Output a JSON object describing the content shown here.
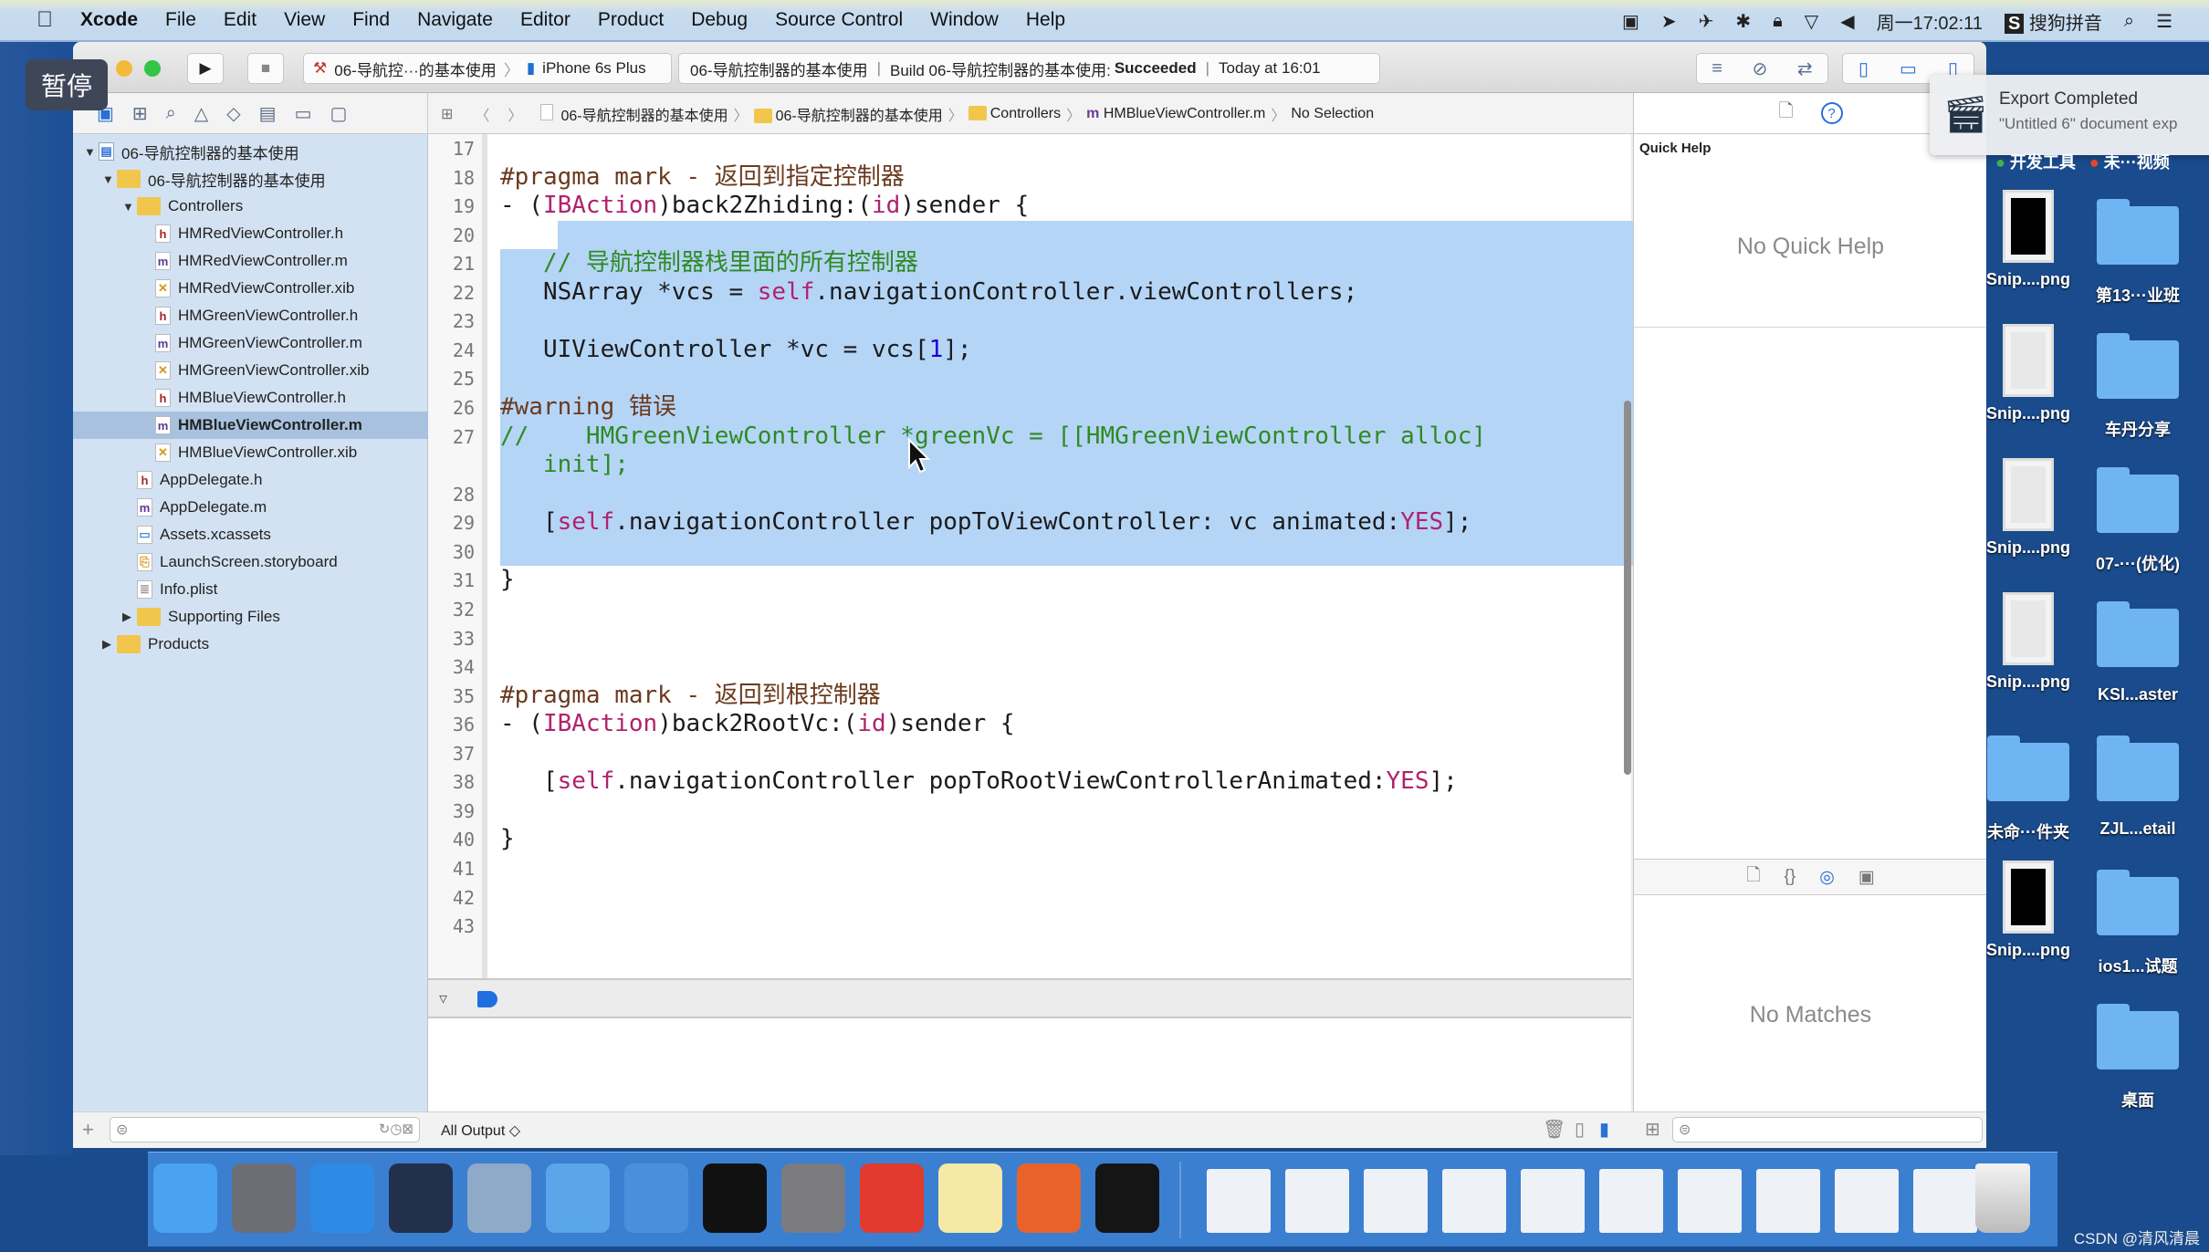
{
  "menubar": {
    "apple_icon": "apple-icon",
    "app": "Xcode",
    "items": [
      "File",
      "Edit",
      "View",
      "Find",
      "Navigate",
      "Editor",
      "Product",
      "Debug",
      "Source Control",
      "Window",
      "Help"
    ],
    "status": {
      "clock": "周一17:02:11",
      "ime": "搜狗拼音"
    }
  },
  "overlay": {
    "pause_badge": "暂停"
  },
  "toolbar": {
    "scheme": "06-导航控···的基本使用",
    "device": "iPhone 6s Plus",
    "activity": {
      "project": "06-导航控制器的基本使用",
      "build_prefix": "Build 06-导航控制器的基本使用:",
      "build_status": "Succeeded",
      "time": "Today at 16:01"
    }
  },
  "jumpbar": {
    "crumbs": [
      "06-导航控制器的基本使用",
      "06-导航控制器的基本使用",
      "Controllers",
      "HMBlueViewController.m",
      "No Selection"
    ]
  },
  "navigator": {
    "items": [
      {
        "label": "06-导航控制器的基本使用",
        "level": 0,
        "type": "project",
        "disclosure": "open"
      },
      {
        "label": "06-导航控制器的基本使用",
        "level": 1,
        "type": "folder",
        "disclosure": "open"
      },
      {
        "label": "Controllers",
        "level": 2,
        "type": "folder",
        "disclosure": "open"
      },
      {
        "label": "HMRedViewController.h",
        "level": 3,
        "type": "h"
      },
      {
        "label": "HMRedViewController.m",
        "level": 3,
        "type": "m"
      },
      {
        "label": "HMRedViewController.xib",
        "level": 3,
        "type": "xib"
      },
      {
        "label": "HMGreenViewController.h",
        "level": 3,
        "type": "h"
      },
      {
        "label": "HMGreenViewController.m",
        "level": 3,
        "type": "m"
      },
      {
        "label": "HMGreenViewController.xib",
        "level": 3,
        "type": "xib"
      },
      {
        "label": "HMBlueViewController.h",
        "level": 3,
        "type": "h"
      },
      {
        "label": "HMBlueViewController.m",
        "level": 3,
        "type": "m",
        "selected": true
      },
      {
        "label": "HMBlueViewController.xib",
        "level": 3,
        "type": "xib"
      },
      {
        "label": "AppDelegate.h",
        "level": 2,
        "type": "h"
      },
      {
        "label": "AppDelegate.m",
        "level": 2,
        "type": "m"
      },
      {
        "label": "Assets.xcassets",
        "level": 2,
        "type": "assets"
      },
      {
        "label": "LaunchScreen.storyboard",
        "level": 2,
        "type": "storyboard"
      },
      {
        "label": "Info.plist",
        "level": 2,
        "type": "plist"
      },
      {
        "label": "Supporting Files",
        "level": 2,
        "type": "folder",
        "disclosure": "closed"
      },
      {
        "label": "Products",
        "level": 1,
        "type": "folder",
        "disclosure": "closed"
      }
    ]
  },
  "editor": {
    "selection": {
      "from_line": 20,
      "to_line": 30
    },
    "rows": [
      {
        "n": "17",
        "t": []
      },
      {
        "n": "18",
        "t": [
          {
            "s": "#pragma mark - 返回到指定控制器",
            "c": "pragma"
          }
        ]
      },
      {
        "n": "19",
        "t": [
          {
            "s": "- ("
          },
          {
            "s": "IBAction",
            "c": "kw"
          },
          {
            "s": ")back2Zhiding:("
          },
          {
            "s": "id",
            "c": "kw"
          },
          {
            "s": ")sender {"
          }
        ]
      },
      {
        "n": "20",
        "t": []
      },
      {
        "n": "21",
        "t": [
          {
            "s": "   "
          },
          {
            "s": "// 导航控制器栈里面的所有控制器",
            "c": "comment"
          }
        ]
      },
      {
        "n": "22",
        "t": [
          {
            "s": "   NSArray *vcs = "
          },
          {
            "s": "self",
            "c": "kw"
          },
          {
            "s": ".navigationController.viewControllers;"
          }
        ]
      },
      {
        "n": "23",
        "t": []
      },
      {
        "n": "24",
        "t": [
          {
            "s": "   UIViewController *vc = vcs["
          },
          {
            "s": "1",
            "c": "num"
          },
          {
            "s": "];"
          }
        ]
      },
      {
        "n": "25",
        "t": []
      },
      {
        "n": "26",
        "t": [
          {
            "s": "#warning 错误",
            "c": "pragma"
          }
        ]
      },
      {
        "n": "27",
        "t": [
          {
            "s": "//    HMGreenViewController *greenVc = [[HMGreenViewController alloc]",
            "c": "comment"
          }
        ]
      },
      {
        "n": "",
        "t": [
          {
            "s": "   init];",
            "c": "comment"
          }
        ]
      },
      {
        "n": "28",
        "t": []
      },
      {
        "n": "29",
        "t": [
          {
            "s": "   ["
          },
          {
            "s": "self",
            "c": "kw"
          },
          {
            "s": ".navigationController popToViewController: vc animated:"
          },
          {
            "s": "YES",
            "c": "kw"
          },
          {
            "s": "];"
          }
        ]
      },
      {
        "n": "30",
        "t": []
      },
      {
        "n": "31",
        "t": [
          {
            "s": "}"
          }
        ]
      },
      {
        "n": "32",
        "t": []
      },
      {
        "n": "33",
        "t": []
      },
      {
        "n": "34",
        "t": []
      },
      {
        "n": "35",
        "t": [
          {
            "s": "#pragma mark - 返回到根控制器",
            "c": "pragma"
          }
        ]
      },
      {
        "n": "36",
        "t": [
          {
            "s": "- ("
          },
          {
            "s": "IBAction",
            "c": "kw"
          },
          {
            "s": ")back2RootVc:("
          },
          {
            "s": "id",
            "c": "kw"
          },
          {
            "s": ")sender {"
          }
        ]
      },
      {
        "n": "37",
        "t": []
      },
      {
        "n": "38",
        "t": [
          {
            "s": "   ["
          },
          {
            "s": "self",
            "c": "kw"
          },
          {
            "s": ".navigationController popToRootViewControllerAnimated:"
          },
          {
            "s": "YES",
            "c": "kw"
          },
          {
            "s": "];"
          }
        ]
      },
      {
        "n": "39",
        "t": []
      },
      {
        "n": "40",
        "t": [
          {
            "s": "}"
          }
        ]
      },
      {
        "n": "41",
        "t": []
      },
      {
        "n": "42",
        "t": []
      },
      {
        "n": "43",
        "t": []
      }
    ]
  },
  "debug": {
    "output_filter": "All Output ◇"
  },
  "inspector": {
    "title": "Quick Help",
    "no_help": "No Quick Help",
    "no_matches": "No Matches"
  },
  "notification": {
    "title": "Export Completed",
    "body": "\"Untitled 6\" document exp"
  },
  "desktop": {
    "tags": [
      "开发工具",
      "未···视频"
    ],
    "tag_colors": [
      "#3fb24a",
      "#e8442c"
    ],
    "items": [
      {
        "label": "Snip....png",
        "kind": "image",
        "col": 0,
        "row": 0
      },
      {
        "label": "第13···业班",
        "kind": "folder",
        "col": 1,
        "row": 0
      },
      {
        "label": "Snip....png",
        "kind": "image",
        "col": 0,
        "row": 1
      },
      {
        "label": "车丹分享",
        "kind": "folder",
        "col": 1,
        "row": 1
      },
      {
        "label": "Snip....png",
        "kind": "image",
        "col": 0,
        "row": 2
      },
      {
        "label": "07-···(优化)",
        "kind": "folder",
        "col": 1,
        "row": 2
      },
      {
        "label": "Snip....png",
        "kind": "image",
        "col": 0,
        "row": 3
      },
      {
        "label": "KSI...aster",
        "kind": "folder",
        "col": 1,
        "row": 3
      },
      {
        "label": "未命···件夹",
        "kind": "folder",
        "col": 0,
        "row": 4
      },
      {
        "label": "ZJL...etail",
        "kind": "folder",
        "col": 1,
        "row": 4
      },
      {
        "label": "Snip....png",
        "kind": "image",
        "col": 0,
        "row": 5
      },
      {
        "label": "ios1...试题",
        "kind": "folder",
        "col": 1,
        "row": 5
      },
      {
        "label": "桌面",
        "kind": "folder",
        "col": 1,
        "row": 6
      }
    ]
  },
  "dock": {
    "apps": [
      {
        "icon": "finder-icon",
        "color": "#4aa3f0"
      },
      {
        "icon": "launchpad-icon",
        "color": "#6d6d75"
      },
      {
        "icon": "safari-icon",
        "color": "#2f8ae6"
      },
      {
        "icon": "mouse-app-icon",
        "color": "#23304c"
      },
      {
        "icon": "screenflow-icon",
        "color": "#8fa9c9"
      },
      {
        "icon": "xcode-icon",
        "color": "#5aa6e8"
      },
      {
        "icon": "instruments-icon",
        "color": "#4b8fdc"
      },
      {
        "icon": "terminal-icon",
        "color": "#111111"
      },
      {
        "icon": "system-preferences-icon",
        "color": "#7b7b80"
      },
      {
        "icon": "xmind-icon",
        "color": "#e23a2e"
      },
      {
        "icon": "notes-icon",
        "color": "#f6e9a8"
      },
      {
        "icon": "powerpoint-icon",
        "color": "#e8622a"
      },
      {
        "icon": "console-icon",
        "color": "#151515"
      }
    ],
    "windows": 10,
    "trash_icon": "trash-icon"
  },
  "watermark": "CSDN @清风清晨"
}
